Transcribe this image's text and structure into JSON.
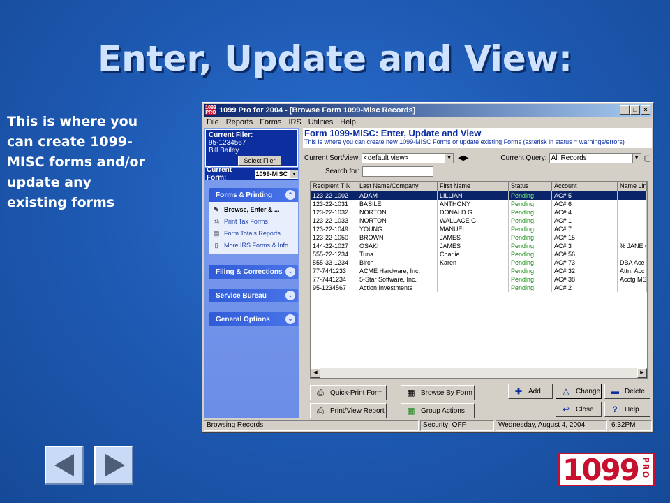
{
  "slide": {
    "title": "Enter, Update and View:",
    "side_text": "This is where you can create 1099-MISC forms and/or update any existing forms"
  },
  "window": {
    "title": "1099 Pro for 2004 - [Browse Form 1099-Misc Records]",
    "logo_text": "1099 PRO",
    "menu": [
      "File",
      "Reports",
      "Forms",
      "IRS",
      "Utilities",
      "Help"
    ]
  },
  "left": {
    "filer_label": "Current Filer:",
    "filer_tin": "95-1234567",
    "filer_name": "Bill Bailey",
    "select_filer": "Select Filer",
    "form_label": "Current Form:",
    "form_value": "1099-MISC",
    "panels": [
      {
        "label": "Forms & Printing"
      },
      {
        "label": "Filing & Corrections"
      },
      {
        "label": "Service Bureau"
      },
      {
        "label": "General Options"
      }
    ],
    "tasks": [
      {
        "label": "Browse, Enter & ...",
        "icon": "pen-icon"
      },
      {
        "label": "Print Tax Forms",
        "icon": "printer-icon"
      },
      {
        "label": "Form Totals Reports",
        "icon": "report-icon"
      },
      {
        "label": "More IRS Forms & Info",
        "icon": "document-icon"
      }
    ]
  },
  "main": {
    "heading": "Form 1099-MISC: Enter, Update and View",
    "subheading": "This is where you can create new 1099-MISC Forms or update existing Forms (asterisk in status = warnings/errors)",
    "sort_label": "Current Sort/view:",
    "sort_value": "<default view>",
    "query_label": "Current Query:",
    "query_value": "All Records",
    "search_label": "Search for:",
    "search_value": "",
    "columns": [
      "Recipient TIN",
      "Last Name/Company",
      "First Name",
      "Status",
      "Account",
      "Name Lin"
    ],
    "rows": [
      [
        "123-22-1002",
        "ADAM",
        "LILLIAN",
        "Pending",
        "AC# 5",
        ""
      ],
      [
        "123-22-1031",
        "BASILE",
        "ANTHONY",
        "Pending",
        "AC# 6",
        ""
      ],
      [
        "123-22-1032",
        "NORTON",
        "DONALD G",
        "Pending",
        "AC# 4",
        ""
      ],
      [
        "123-22-1033",
        "NORTON",
        "WALLACE G",
        "Pending",
        "AC# 1",
        ""
      ],
      [
        "123-22-1049",
        "YOUNG",
        "MANUEL",
        "Pending",
        "AC# 7",
        ""
      ],
      [
        "123-22-1050",
        "BROWN",
        "JAMES",
        "Pending",
        "AC# 15",
        ""
      ],
      [
        "144-22-1027",
        "OSAKI",
        "JAMES",
        "Pending",
        "AC# 3",
        "% JANE C"
      ],
      [
        "555-22-1234",
        "Tuna",
        "Charlie",
        "Pending",
        "AC# 56",
        ""
      ],
      [
        "555-33-1234",
        "Birch",
        "Karen",
        "Pending",
        "AC# 73",
        "DBA Ace"
      ],
      [
        "77-7441233",
        "ACME Hardware, Inc.",
        "",
        "Pending",
        "AC# 32",
        "Attn: Acc"
      ],
      [
        "77-7441234",
        "5-Star Software, Inc.",
        "",
        "Pending",
        "AC# 38",
        "Acctg MS"
      ],
      [
        "95-1234567",
        "Action Investments",
        "",
        "Pending",
        "AC# 2",
        ""
      ]
    ],
    "buttons": {
      "quick_print": "Quick-Print Form",
      "browse_by_form": "Browse By Form",
      "add": "Add",
      "change": "Change",
      "delete": "Delete",
      "print_view": "Print/View Report",
      "group_actions": "Group Actions",
      "close": "Close",
      "help": "Help"
    }
  },
  "status": {
    "left": "Browsing Records",
    "security": "Security: OFF",
    "date": "Wednesday, August 4, 2004",
    "time": "6:32PM"
  },
  "brand": {
    "logo_number": "1099",
    "logo_pro": "PRO"
  },
  "colors": {
    "background": "#1f5fb5",
    "title_bar": "#0a246a",
    "selected_row": "#0a246a",
    "status_pending": "#0a8a0a",
    "brand_red": "#c8102e"
  }
}
